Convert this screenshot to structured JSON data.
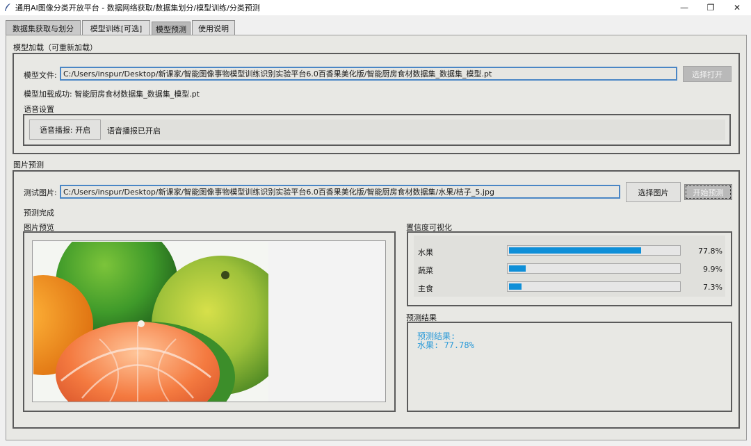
{
  "window": {
    "title": "通用AI图像分类开放平台 - 数据网络获取/数据集划分/模型训练/分类预测",
    "controls": {
      "minimize": "—",
      "restore": "❐",
      "close": "✕"
    }
  },
  "tabs": [
    {
      "label": "数据集获取与划分"
    },
    {
      "label": "模型训练[可选]"
    },
    {
      "label": "模型预测"
    },
    {
      "label": "使用说明"
    }
  ],
  "model_load": {
    "section_title": "模型加载（可重新加载）",
    "file_label": "模型文件:",
    "file_path": "C:/Users/inspur/Desktop/新课家/智能图像事物模型训练识别实验平台6.0百香果美化版/智能厨房食材数据集_数据集_模型.pt",
    "open_button": "选择打开",
    "status": "模型加载成功: 智能厨房食材数据集_数据集_模型.pt",
    "voice_title": "语音设置",
    "voice_button": "语音播报: 开启",
    "voice_status": "语音播报已开启"
  },
  "predict": {
    "section_title": "图片预测",
    "test_label": "测试图片:",
    "test_path": "C:/Users/inspur/Desktop/新课家/智能图像事物模型训练识别实验平台6.0百香果美化版/智能厨房食材数据集/水果/桔子_5.jpg",
    "choose_button": "选择图片",
    "start_button": "开始预测",
    "status": "预测完成",
    "preview_title": "图片预览",
    "confidence_title": "置信度可视化",
    "result_title": "预测结果",
    "result_line1": "预测结果:",
    "result_line2": "水果: 77.78%"
  },
  "confidence": [
    {
      "name": "水果",
      "value": 77.8,
      "label": "77.8%"
    },
    {
      "name": "蔬菜",
      "value": 9.9,
      "label": "9.9%"
    },
    {
      "name": "主食",
      "value": 7.3,
      "label": "7.3%"
    }
  ],
  "colors": {
    "accent": "#0f8fd8",
    "result_text": "#2a9ad8",
    "focus_border": "#4a86c5"
  },
  "icons": {
    "app": "feather-icon"
  }
}
